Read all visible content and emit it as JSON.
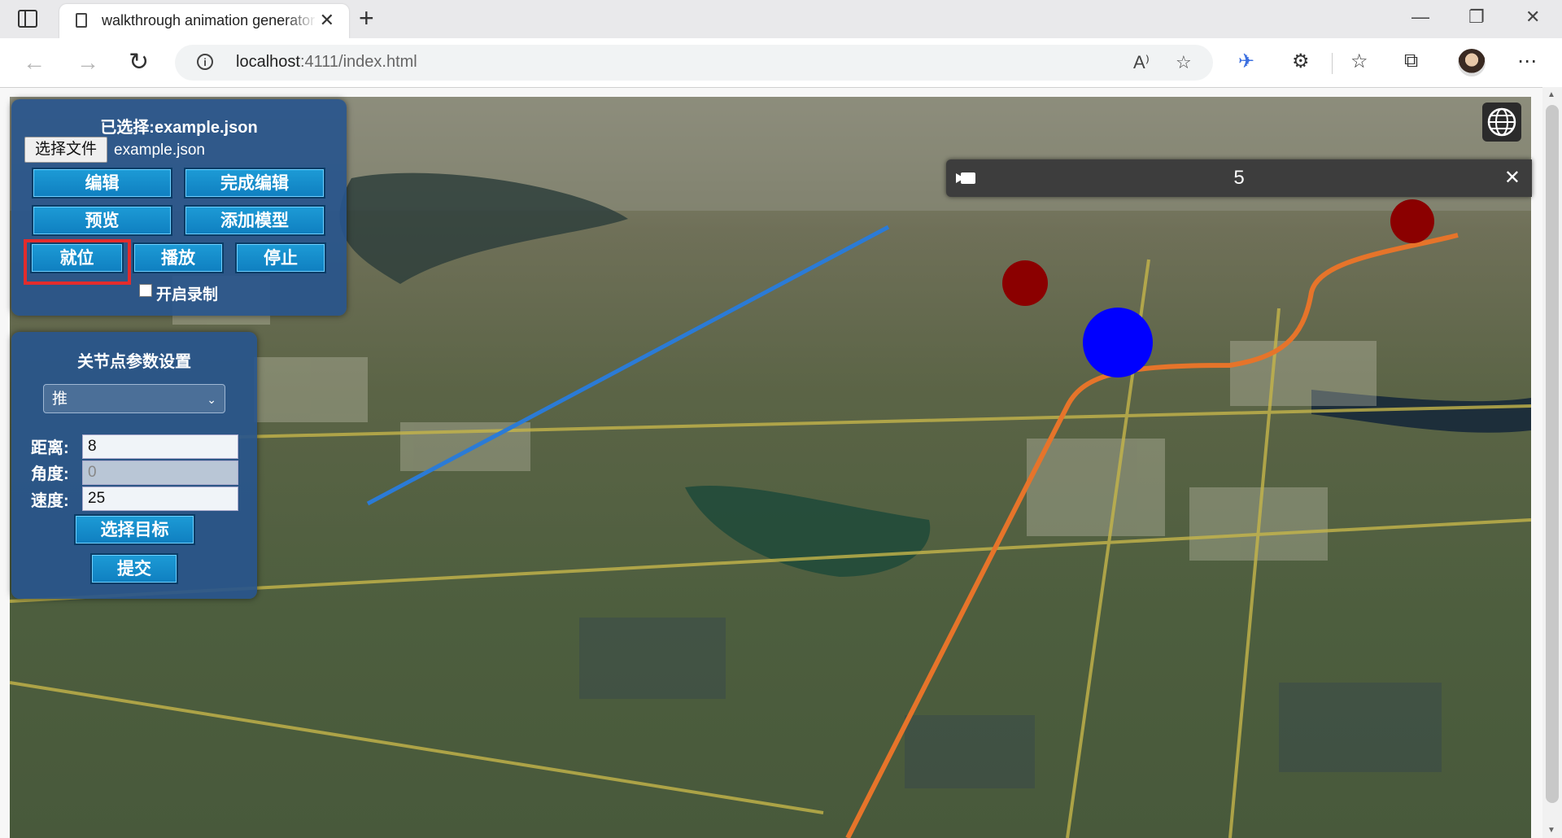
{
  "browser": {
    "tab_title": "walkthrough animation generator",
    "tab_close": "✕",
    "new_tab": "+",
    "url_host": "localhost",
    "url_rest": ":4111/index.html",
    "window_controls": {
      "minimize": "—",
      "restore": "❐",
      "close": "✕"
    }
  },
  "panel": {
    "selected_title": "已选择:example.json",
    "file_button": "选择文件",
    "file_name": "example.json",
    "buttons": {
      "edit": "编辑",
      "finish_edit": "完成编辑",
      "preview": "预览",
      "add_model": "添加模型",
      "position": "就位",
      "play": "播放",
      "stop": "停止"
    },
    "record_label": "开启录制",
    "record_checked": false
  },
  "keyframe": {
    "title": "关节点参数设置",
    "mode_selected": "推",
    "distance_label": "距离:",
    "distance_value": "8",
    "angle_label": "角度:",
    "angle_placeholder": "0",
    "speed_label": "速度:",
    "speed_value": "25",
    "select_target": "选择目标",
    "submit": "提交"
  },
  "popup": {
    "number": "5",
    "close": "✕"
  },
  "colors": {
    "panel_bg": "#28558c",
    "button": "#1d9bd6",
    "highlight": "#e32c2c",
    "marker_red": "#8b0000",
    "marker_blue": "#0000ff"
  }
}
